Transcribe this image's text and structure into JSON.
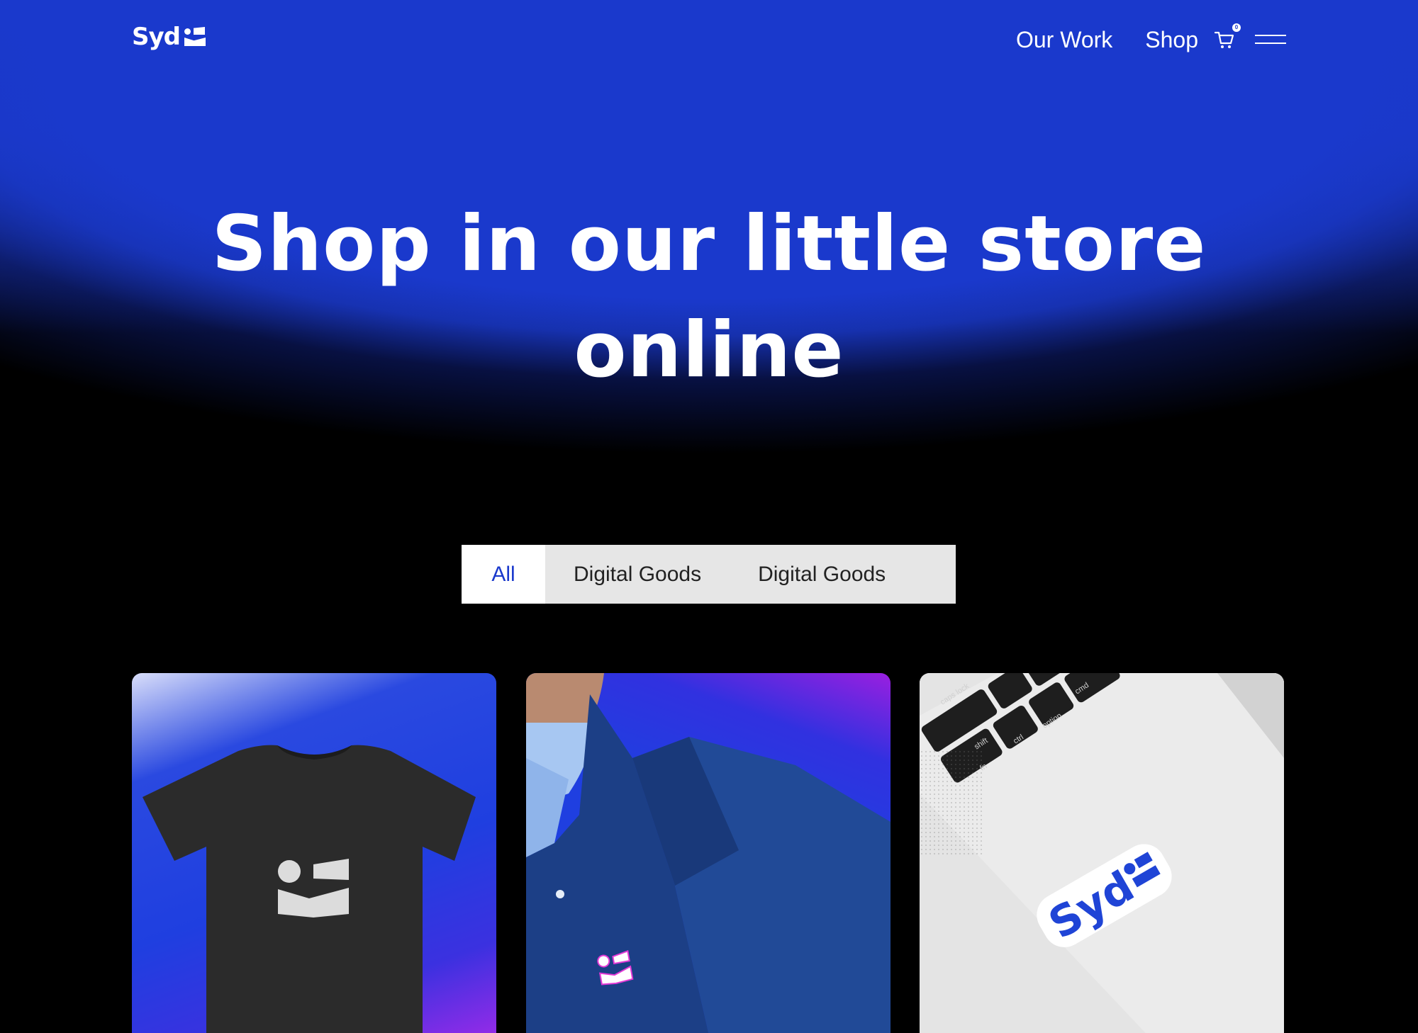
{
  "brand": {
    "logo_text": "Syd",
    "accent_color": "#1a39cc"
  },
  "nav": {
    "links": [
      {
        "label": "Our Work"
      },
      {
        "label": "Shop"
      }
    ],
    "cart_count": "0",
    "cart_icon": "cart-icon",
    "menu_icon": "hamburger-menu-icon"
  },
  "hero": {
    "title_line1": "Shop in our little store",
    "title_line2": "online"
  },
  "filter_tabs": [
    {
      "label": "All",
      "active": true
    },
    {
      "label": "Digital Goods",
      "active": false
    },
    {
      "label": "Digital Goods",
      "active": false
    }
  ],
  "products": [
    {
      "image": "t-shirt-product-image"
    },
    {
      "image": "pin-product-image"
    },
    {
      "image": "sticker-product-image"
    }
  ],
  "sticker_text": "Syd",
  "keyboard_keys": [
    "caps lock",
    "shift",
    "ctrl",
    "option",
    "cmd",
    "fn"
  ]
}
